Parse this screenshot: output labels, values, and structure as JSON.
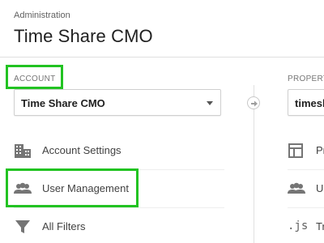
{
  "header": {
    "breadcrumb": "Administration",
    "title": "Time Share CMO"
  },
  "account": {
    "section_label": "ACCOUNT",
    "selected": "Time Share CMO",
    "menu": [
      {
        "label": "Account Settings",
        "icon": "building-icon"
      },
      {
        "label": "User Management",
        "icon": "users-icon"
      },
      {
        "label": "All Filters",
        "icon": "filter-icon"
      }
    ]
  },
  "property": {
    "section_label": "PROPERT",
    "selected": "timesh",
    "menu": [
      {
        "label": "Pr",
        "icon": "layout-icon"
      },
      {
        "label": "Us",
        "icon": "users-icon"
      },
      {
        "label": "Tr",
        "icon": "js-icon",
        "glyph": ".js"
      }
    ]
  },
  "colors": {
    "highlight": "#22c322",
    "divider": "#e0e0e0",
    "icon": "#757575"
  }
}
